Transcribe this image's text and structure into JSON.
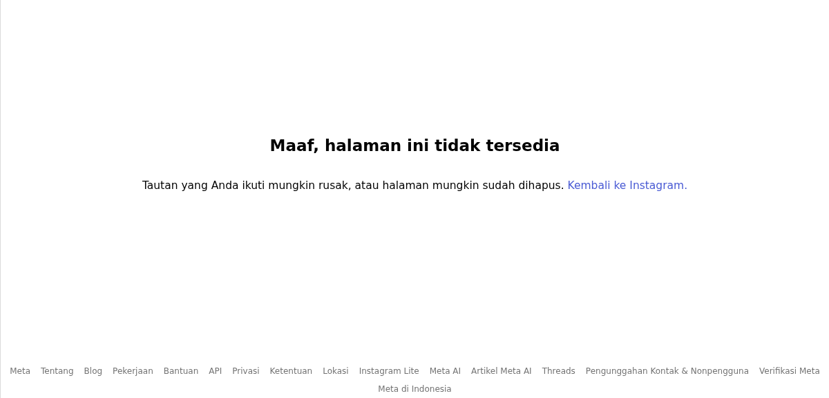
{
  "error": {
    "title": "Maaf, halaman ini tidak tersedia",
    "message": "Tautan yang Anda ikuti mungkin rusak, atau halaman mungkin sudah dihapus.",
    "link": "Kembali ke Instagram."
  },
  "footer": {
    "links": [
      "Meta",
      "Tentang",
      "Blog",
      "Pekerjaan",
      "Bantuan",
      "API",
      "Privasi",
      "Ketentuan",
      "Lokasi",
      "Instagram Lite",
      "Meta AI",
      "Artikel Meta AI",
      "Threads",
      "Pengunggahan Kontak & Nonpengguna",
      "Verifikasi Meta"
    ],
    "locale": "Meta di Indonesia"
  }
}
